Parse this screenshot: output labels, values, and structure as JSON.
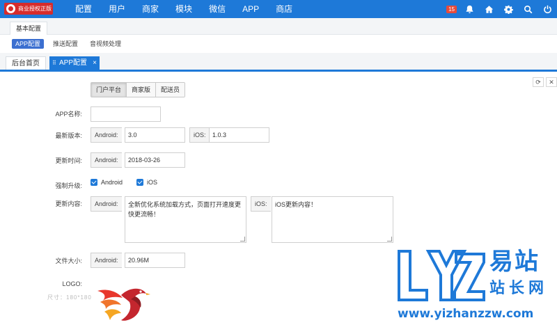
{
  "header": {
    "brand_label": "商业授权正版",
    "nav": [
      "配置",
      "用户",
      "商家",
      "模块",
      "微信",
      "APP",
      "商店"
    ],
    "notification_count": "15",
    "colors": {
      "primary": "#1e79d8",
      "brand_red": "#d62c2c",
      "badge_red": "#e84a3a"
    },
    "icons": [
      "bell-icon",
      "home-icon",
      "gear-icon",
      "search-icon",
      "power-icon"
    ]
  },
  "subnav": {
    "section_tab": "基本配置",
    "items": [
      "APP配置",
      "推送配置",
      "音视频处理"
    ],
    "active_item": "APP配置"
  },
  "page_tabs": {
    "home": "后台首页",
    "current": "APP配置",
    "close_glyph": "×"
  },
  "form": {
    "segments": [
      "门户平台",
      "商家版",
      "配送员"
    ],
    "active_segment": "门户平台",
    "app_name": {
      "label": "APP名称:",
      "value": ""
    },
    "latest_version": {
      "label": "最新版本:",
      "android_addon": "Android:",
      "android_value": "3.0",
      "ios_addon": "iOS:",
      "ios_value": "1.0.3"
    },
    "update_time": {
      "label": "更新时间:",
      "android_addon": "Android:",
      "android_value": "2018-03-26"
    },
    "force_update": {
      "label": "强制升级:",
      "android": "Android",
      "ios": "iOS",
      "android_checked": true,
      "ios_checked": true
    },
    "update_content": {
      "label": "更新内容:",
      "android_addon": "Android:",
      "android_value": "全新优化系统加载方式，页面打开速度更快更流畅！",
      "ios_addon": "iOS:",
      "ios_value": "iOS更新内容！"
    },
    "file_size": {
      "label": "文件大小:",
      "android_addon": "Android:",
      "android_value": "20.96M"
    },
    "logo": {
      "label": "LOGO:",
      "hint": "尺寸：180*180"
    }
  },
  "watermark": {
    "latin": "LYZ",
    "cn_line1": "易站",
    "cn_line2": "站长网",
    "url": "www.yizhanzzw.com"
  }
}
